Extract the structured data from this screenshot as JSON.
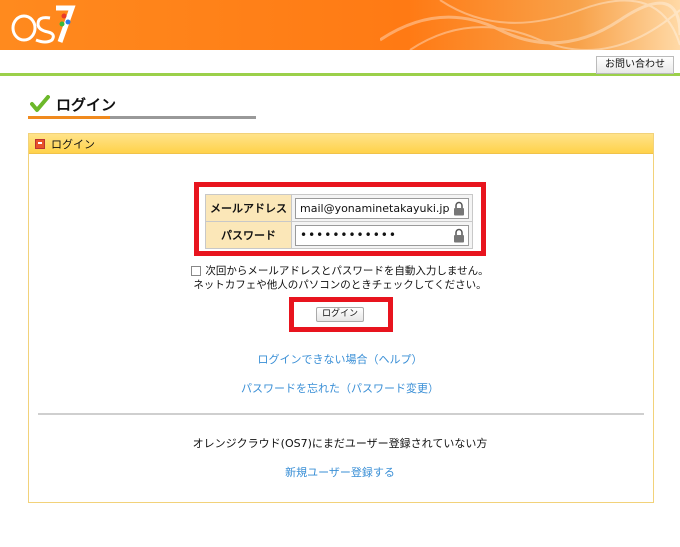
{
  "header": {
    "logo_text": "OS7",
    "inquiry_label": "お問い合わせ"
  },
  "page": {
    "title": "ログイン"
  },
  "panel": {
    "title": "ログイン"
  },
  "form": {
    "email_label": "メールアドレス",
    "email_value": "mail@yonaminetakayuki.jp",
    "password_label": "パスワード",
    "password_value": "••••••••••••"
  },
  "remember": {
    "line1": "次回からメールアドレスとパスワードを自動入力しません。",
    "line2": "ネットカフェや他人のパソコンのときチェックしてください。"
  },
  "login_button": "ログイン",
  "links": {
    "help": "ログインできない場合（ヘルプ）",
    "forgot_password": "パスワードを忘れた（パスワード変更）",
    "register": "新規ユーザー登録する"
  },
  "not_registered_text": "オレンジクラウド(OS7)にまだユーザー登録されていない方",
  "colors": {
    "header_orange": "#ff7a14",
    "accent_green": "#9bd04a",
    "link_blue": "#3a8fd6",
    "highlight_red": "#e8141e"
  }
}
